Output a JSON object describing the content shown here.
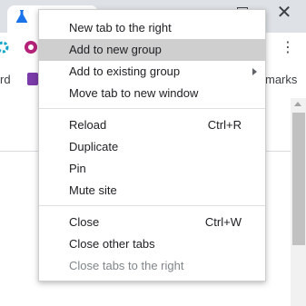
{
  "background": {
    "bookmark_left_text": "rd",
    "bookmarks_right_text": "marks"
  },
  "context_menu": {
    "items": [
      {
        "label": "New tab to the right",
        "shortcut": ""
      },
      {
        "label": "Add to new group",
        "shortcut": "",
        "highlighted": true
      },
      {
        "label": "Add to existing group",
        "shortcut": "",
        "submenu": true
      },
      {
        "label": "Move tab to new window",
        "shortcut": ""
      },
      {
        "label": "Reload",
        "shortcut": "Ctrl+R"
      },
      {
        "label": "Duplicate",
        "shortcut": ""
      },
      {
        "label": "Pin",
        "shortcut": ""
      },
      {
        "label": "Mute site",
        "shortcut": ""
      },
      {
        "label": "Close",
        "shortcut": "Ctrl+W"
      },
      {
        "label": "Close other tabs",
        "shortcut": ""
      },
      {
        "label": "Close tabs to the right",
        "shortcut": "",
        "disabled": true
      }
    ]
  },
  "icons": {
    "tab_favicon": "flask-icon",
    "window_close": "close-icon",
    "window_maximize": "maximize-icon",
    "menu": "kebab-menu-icon",
    "submenu": "chevron-right-icon"
  },
  "colors": {
    "highlight": "#cfcfcf",
    "disabled_text": "#80868b",
    "tab_favicon": "#1a73e8",
    "onenote": "#7b3ba8"
  }
}
